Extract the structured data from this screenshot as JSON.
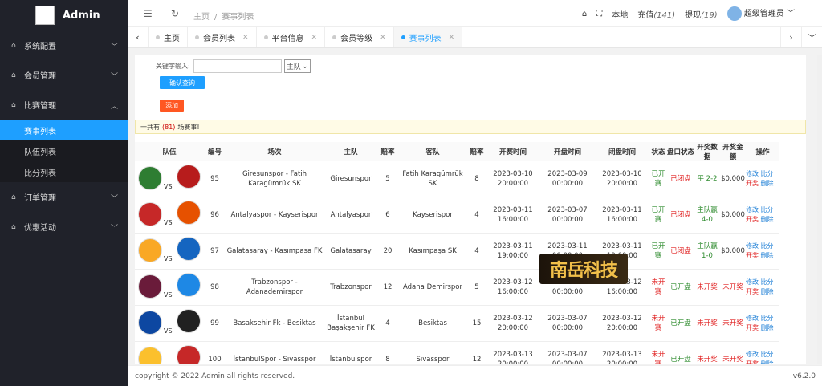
{
  "app": {
    "title": "Admin"
  },
  "sidebar": {
    "items": [
      {
        "label": "系统配置"
      },
      {
        "label": "会员管理"
      },
      {
        "label": "比赛管理"
      },
      {
        "label": "订单管理"
      },
      {
        "label": "优惠活动"
      }
    ],
    "sub_items": [
      {
        "label": "赛事列表"
      },
      {
        "label": "队伍列表"
      },
      {
        "label": "比分列表"
      }
    ]
  },
  "header": {
    "breadcrumb": [
      "主页",
      "/",
      "赛事列表"
    ],
    "local": "本地",
    "recharge": "充值",
    "recharge_count": "(141)",
    "withdraw": "提现",
    "withdraw_count": "(19)",
    "user": "超级管理员"
  },
  "tabs": [
    {
      "label": "主页"
    },
    {
      "label": "会员列表"
    },
    {
      "label": "平台信息"
    },
    {
      "label": "会员等级"
    },
    {
      "label": "赛事列表"
    }
  ],
  "search": {
    "label": "关键字输入:",
    "placeholder": "",
    "select_value": "主队",
    "query_button": "确认查询",
    "add_button": "添加"
  },
  "notice": {
    "prefix": "一共有",
    "count": "(81)",
    "suffix": "场赛事!"
  },
  "table": {
    "headers": [
      "队伍",
      "编号",
      "场次",
      "主队",
      "赔率",
      "客队",
      "赔率",
      "开赛时间",
      "开盘时间",
      "闭盘时间",
      "状态",
      "盘口状态",
      "开奖数据",
      "开奖金额",
      "操作"
    ],
    "rows": [
      {
        "vs": "VS",
        "id": "95",
        "match": "Giresunspor - Fatih Karagümrük SK",
        "home": "Giresunspor",
        "home_odds": "5",
        "away": "Fatih Karagümrük SK",
        "away_odds": "8",
        "start": "2023-03-10 20:00:00",
        "open": "2023-03-09 00:00:00",
        "close": "2023-03-10 20:00:00",
        "status": "已开赛",
        "market": "已闭盘",
        "result": "平 2-2",
        "amount": "$0.000",
        "edit": "修改",
        "score": "比分",
        "draw": "开奖",
        "del": "删除"
      },
      {
        "vs": "VS",
        "id": "96",
        "match": "Antalyaspor - Kayserispor",
        "home": "Antalyaspor",
        "home_odds": "6",
        "away": "Kayserispor",
        "away_odds": "4",
        "start": "2023-03-11 16:00:00",
        "open": "2023-03-07 00:00:00",
        "close": "2023-03-11 16:00:00",
        "status": "已开赛",
        "market": "已闭盘",
        "result": "主队赢 4-0",
        "amount": "$0.000",
        "edit": "修改",
        "score": "比分",
        "draw": "开奖",
        "del": "删除"
      },
      {
        "vs": "VS",
        "id": "97",
        "match": "Galatasaray - Kasımpasa FK",
        "home": "Galatasaray",
        "home_odds": "20",
        "away": "Kasımpaşa SK",
        "away_odds": "4",
        "start": "2023-03-11 19:00:00",
        "open": "2023-03-11 00:00:00",
        "close": "2023-03-11 19:00:00",
        "status": "已开赛",
        "market": "已闭盘",
        "result": "主队赢 1-0",
        "amount": "$0.000",
        "edit": "修改",
        "score": "比分",
        "draw": "开奖",
        "del": "删除"
      },
      {
        "vs": "VS",
        "id": "98",
        "match": "Trabzonspor - Adanademirspor",
        "home": "Trabzonspor",
        "home_odds": "12",
        "away": "Adana Demirspor",
        "away_odds": "5",
        "start": "2023-03-12 16:00:00",
        "open": "2023-03-07 00:00:00",
        "close": "2023-03-12 16:00:00",
        "status": "未开赛",
        "market": "已开盘",
        "result": "未开奖",
        "amount": "未开奖",
        "edit": "修改",
        "score": "比分",
        "draw": "开奖",
        "del": "删除"
      },
      {
        "vs": "VS",
        "id": "99",
        "match": "Basaksehir Fk - Besiktas",
        "home": "İstanbul Başakşehir FK",
        "home_odds": "4",
        "away": "Besiktas",
        "away_odds": "15",
        "start": "2023-03-12 20:00:00",
        "open": "2023-03-07 00:00:00",
        "close": "2023-03-12 20:00:00",
        "status": "未开赛",
        "market": "已开盘",
        "result": "未开奖",
        "amount": "未开奖",
        "edit": "修改",
        "score": "比分",
        "draw": "开奖",
        "del": "删除"
      },
      {
        "vs": "VS",
        "id": "100",
        "match": "İstanbulSpor - Sivasspor",
        "home": "İstanbulspor",
        "home_odds": "8",
        "away": "Sivasspor",
        "away_odds": "12",
        "start": "2023-03-13 20:00:00",
        "open": "2023-03-07 00:00:00",
        "close": "2023-03-13 20:00:00",
        "status": "未开赛",
        "market": "已开盘",
        "result": "未开奖",
        "amount": "未开奖",
        "edit": "修改",
        "score": "比分",
        "draw": "开奖",
        "del": "删除"
      }
    ]
  },
  "watermark": "南岳科技",
  "footer": {
    "copyright": "copyright © 2022 Admin all rights reserved.",
    "version": "v6.2.0"
  },
  "colors": {
    "accent": "#1e9fff",
    "danger": "#ff5722",
    "sidebar": "#20222a",
    "green": "#2e8b2e",
    "red": "#e02020"
  }
}
